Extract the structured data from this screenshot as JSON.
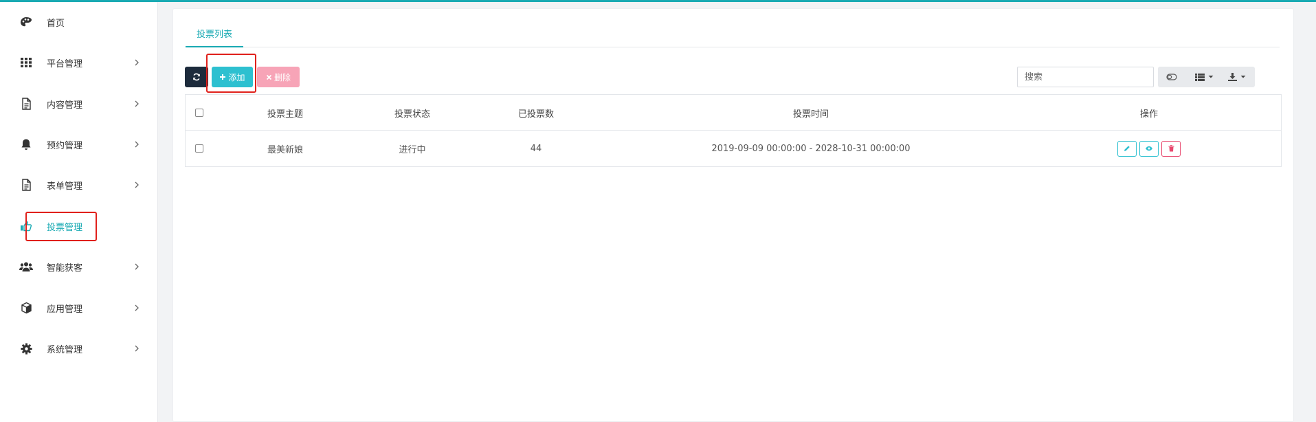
{
  "sidebar": {
    "items": [
      {
        "label": "首页",
        "icon": "palette-icon",
        "has_arrow": false,
        "active": false
      },
      {
        "label": "平台管理",
        "icon": "grid-icon",
        "has_arrow": true,
        "active": false
      },
      {
        "label": "内容管理",
        "icon": "document-icon",
        "has_arrow": true,
        "active": false
      },
      {
        "label": "预约管理",
        "icon": "bell-icon",
        "has_arrow": true,
        "active": false
      },
      {
        "label": "表单管理",
        "icon": "form-icon",
        "has_arrow": true,
        "active": false
      },
      {
        "label": "投票管理",
        "icon": "thumbs-up-icon",
        "has_arrow": false,
        "active": true
      },
      {
        "label": "智能获客",
        "icon": "users-icon",
        "has_arrow": true,
        "active": false
      },
      {
        "label": "应用管理",
        "icon": "cube-icon",
        "has_arrow": true,
        "active": false
      },
      {
        "label": "系统管理",
        "icon": "gear-icon",
        "has_arrow": true,
        "active": false
      }
    ]
  },
  "tabs": [
    {
      "label": "投票列表",
      "active": true
    }
  ],
  "toolbar": {
    "add_label": "添加",
    "delete_label": "删除",
    "search_placeholder": "搜索"
  },
  "table": {
    "columns": [
      "投票主题",
      "投票状态",
      "已投票数",
      "投票时间",
      "操作"
    ],
    "rows": [
      {
        "subject": "最美新娘",
        "status": "进行中",
        "votes": "44",
        "time": "2019-09-09 00:00:00 - 2028-10-31 00:00:00"
      }
    ]
  },
  "colors": {
    "accent": "#19aab3",
    "add_button": "#2dc0d0",
    "delete_button": "#f7a4b7",
    "refresh_button": "#1d2b3c",
    "highlight_box": "#e0201b"
  }
}
